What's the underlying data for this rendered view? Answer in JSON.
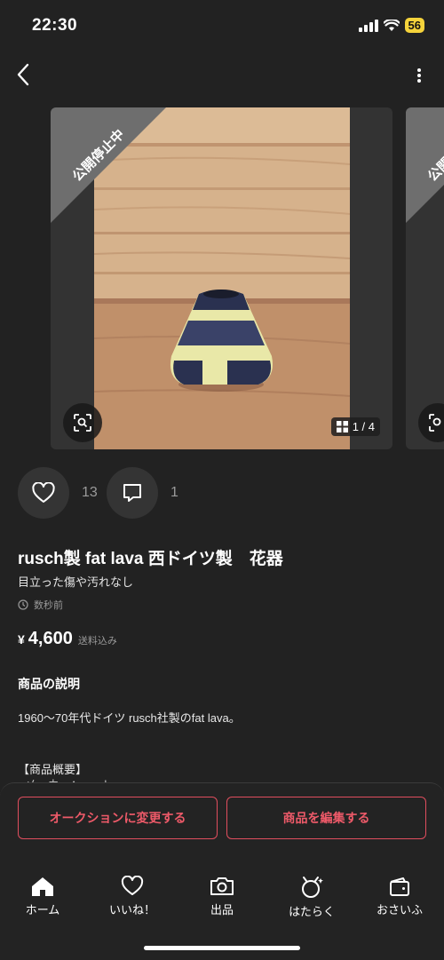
{
  "status": {
    "time": "22:30",
    "battery": "56"
  },
  "product": {
    "banner": "公開停止中",
    "image_counter": "1 / 4",
    "likes_count": "13",
    "comments_count": "1",
    "title": "rusch製 fat lava 西ドイツ製　花器",
    "condition": "目立った傷や汚れなし",
    "posted_time": "数秒前",
    "currency": "¥",
    "price": "4,600",
    "shipping": "送料込み"
  },
  "description": {
    "section_title": "商品の説明",
    "text": "1960〜70年代ドイツ rusch社製のfat lava。",
    "overview_label": "【商品概要】",
    "overview_line": "●メーカー：rusch"
  },
  "actions": {
    "auction_label": "オークションに変更する",
    "edit_label": "商品を編集する"
  },
  "tabbar": {
    "items": [
      {
        "label": "ホーム",
        "icon": "home-icon"
      },
      {
        "label": "いいね！",
        "icon": "heart-icon"
      },
      {
        "label": "出品",
        "icon": "camera-icon"
      },
      {
        "label": "はたらく",
        "icon": "work-icon"
      },
      {
        "label": "おさいふ",
        "icon": "wallet-icon"
      }
    ]
  },
  "colors": {
    "accent": "#e04e5e",
    "background": "#222222",
    "banner": "#6e6e6e"
  }
}
